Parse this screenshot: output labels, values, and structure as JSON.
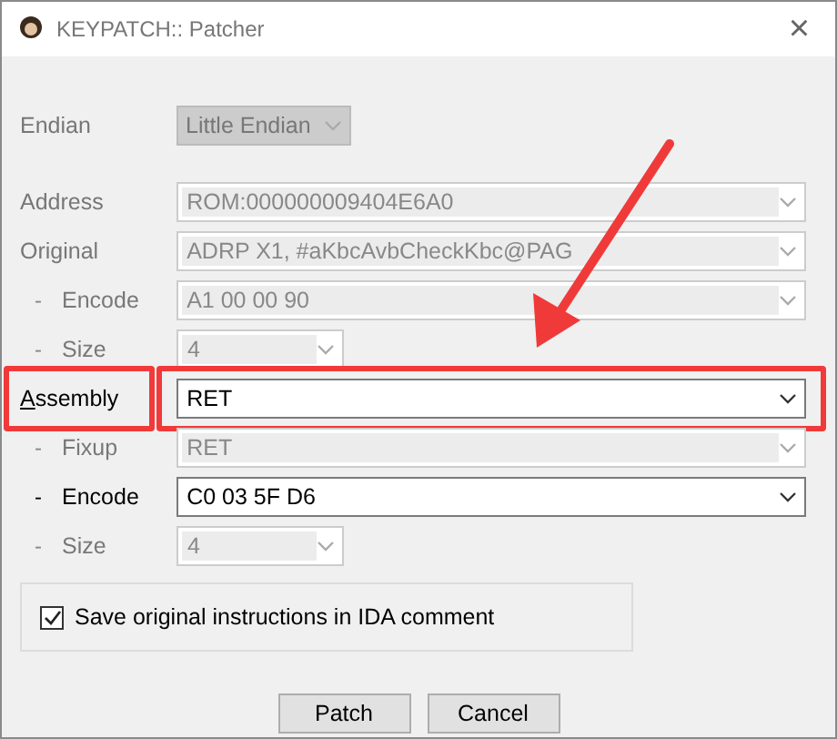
{
  "window": {
    "title": "KEYPATCH:: Patcher",
    "close": "×"
  },
  "endian": {
    "label": "Endian",
    "value": "Little Endian",
    "disabled": true
  },
  "rows": [
    {
      "label": "Address",
      "value": "ROM:000000009404E6A0",
      "disabled": true,
      "kind": "wide",
      "mnemonic": false,
      "highlighted": false
    },
    {
      "label": "Original",
      "value": "ADRP X1, #aKbcAvbCheckKbc@PAG",
      "disabled": true,
      "kind": "wide",
      "mnemonic": false,
      "highlighted": false
    },
    {
      "label": "Encode",
      "prefix": "-",
      "value": "A1 00 00 90",
      "disabled": true,
      "kind": "wide",
      "mnemonic": false,
      "highlighted": false
    },
    {
      "label": "Size",
      "prefix": "-",
      "value": "4",
      "disabled": true,
      "kind": "short",
      "mnemonic": false,
      "highlighted": false
    },
    {
      "label": "Assembly",
      "value": "RET",
      "disabled": false,
      "kind": "wide",
      "mnemonic": true,
      "highlighted": true
    },
    {
      "label": "Fixup",
      "prefix": "-",
      "value": "RET",
      "disabled": true,
      "kind": "wide",
      "mnemonic": false,
      "highlighted": false
    },
    {
      "label": "Encode",
      "prefix": "-",
      "value": "C0 03 5F D6",
      "disabled": false,
      "kind": "wide",
      "mnemonic": false,
      "highlighted": false
    },
    {
      "label": "Size",
      "prefix": "-",
      "value": "4",
      "disabled": true,
      "kind": "short",
      "mnemonic": false,
      "highlighted": false
    }
  ],
  "option": {
    "label": "Save original instructions in IDA comment",
    "checked": true
  },
  "buttons": [
    "Patch",
    "Cancel"
  ]
}
